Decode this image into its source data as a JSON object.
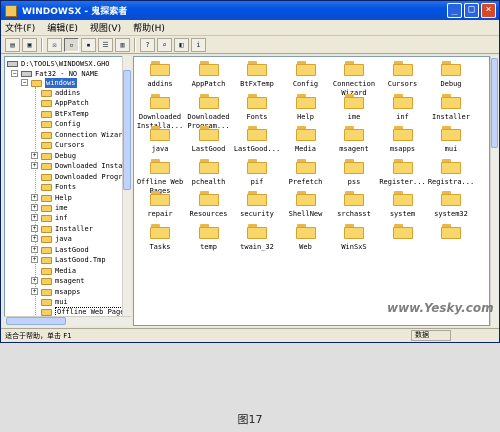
{
  "window": {
    "title": "WINDOWSX - 鬼探索者",
    "minimize_label": "_",
    "maximize_label": "□",
    "close_label": "×"
  },
  "menu": [
    {
      "label": "文件(F)"
    },
    {
      "label": "编辑(E)"
    },
    {
      "label": "视图(V)"
    },
    {
      "label": "帮助(H)"
    }
  ],
  "toolbar": {
    "buttons": [
      {
        "name": "open-folder-icon",
        "glyph": "▤",
        "pressed": false
      },
      {
        "name": "save-icon",
        "glyph": "▣",
        "pressed": false
      },
      {
        "name": "properties-icon",
        "glyph": "☒",
        "pressed": false
      },
      {
        "name": "large-icons-view",
        "glyph": "▫",
        "pressed": true
      },
      {
        "name": "small-icons-view",
        "glyph": "▪",
        "pressed": false
      },
      {
        "name": "list-view",
        "glyph": "☰",
        "pressed": false
      },
      {
        "name": "details-view",
        "glyph": "▥",
        "pressed": false
      },
      {
        "name": "help-icon",
        "glyph": "?",
        "pressed": false
      },
      {
        "name": "find-icon",
        "glyph": "⌕",
        "pressed": false
      },
      {
        "name": "book-icon",
        "glyph": "◧",
        "pressed": false
      },
      {
        "name": "info-icon",
        "glyph": "i",
        "pressed": false
      }
    ]
  },
  "tree": {
    "path": "D:\\TOOLS\\WINDOWSX.GHO",
    "root": "Fat32 - NO NAME",
    "selected": "windows",
    "items": [
      {
        "label": "addins",
        "expander": ""
      },
      {
        "label": "AppPatch",
        "expander": ""
      },
      {
        "label": "BtFxTemp",
        "expander": ""
      },
      {
        "label": "Config",
        "expander": ""
      },
      {
        "label": "Connection Wizard",
        "expander": ""
      },
      {
        "label": "Cursors",
        "expander": ""
      },
      {
        "label": "Debug",
        "expander": "+"
      },
      {
        "label": "Downloaded Installations",
        "expander": "+"
      },
      {
        "label": "Downloaded Program Files",
        "expander": ""
      },
      {
        "label": "Fonts",
        "expander": ""
      },
      {
        "label": "Help",
        "expander": "+"
      },
      {
        "label": "ime",
        "expander": "+"
      },
      {
        "label": "inf",
        "expander": "+"
      },
      {
        "label": "Installer",
        "expander": "+"
      },
      {
        "label": "java",
        "expander": "+"
      },
      {
        "label": "LastGood",
        "expander": "+"
      },
      {
        "label": "LastGood.Tmp",
        "expander": "+"
      },
      {
        "label": "Media",
        "expander": ""
      },
      {
        "label": "msagent",
        "expander": "+"
      },
      {
        "label": "msapps",
        "expander": "+"
      },
      {
        "label": "mui",
        "expander": ""
      },
      {
        "label": "Offline Web Pages",
        "expander": ""
      }
    ]
  },
  "files": [
    {
      "label": "addins"
    },
    {
      "label": "AppPatch"
    },
    {
      "label": "BtFxTemp"
    },
    {
      "label": "Config"
    },
    {
      "label": "Connection\nWizard"
    },
    {
      "label": "Cursors"
    },
    {
      "label": "Debug"
    },
    {
      "label": "Downloaded\nInstalla..."
    },
    {
      "label": "Downloaded\nProgram..."
    },
    {
      "label": "Fonts"
    },
    {
      "label": "Help"
    },
    {
      "label": "ime"
    },
    {
      "label": "inf"
    },
    {
      "label": "Installer"
    },
    {
      "label": "java"
    },
    {
      "label": "LastGood"
    },
    {
      "label": "LastGood..."
    },
    {
      "label": "Media"
    },
    {
      "label": "msagent"
    },
    {
      "label": "msapps"
    },
    {
      "label": "mui"
    },
    {
      "label": "Offline Web\nPages"
    },
    {
      "label": "pchealth"
    },
    {
      "label": "pif"
    },
    {
      "label": "Prefetch"
    },
    {
      "label": "pss"
    },
    {
      "label": "Register..."
    },
    {
      "label": "Registra..."
    },
    {
      "label": "repair"
    },
    {
      "label": "Resources"
    },
    {
      "label": "security"
    },
    {
      "label": "ShellNew"
    },
    {
      "label": "srchasst"
    },
    {
      "label": "system"
    },
    {
      "label": "system32"
    },
    {
      "label": "Tasks"
    },
    {
      "label": "temp"
    },
    {
      "label": "twain_32"
    },
    {
      "label": "Web"
    },
    {
      "label": "WinSxS"
    },
    {
      "label": ""
    },
    {
      "label": ""
    }
  ],
  "status": {
    "text": "适合于帮助，单击 F1",
    "panel": "数据"
  },
  "watermark": "www.Yesky.com",
  "caption": "图17"
}
